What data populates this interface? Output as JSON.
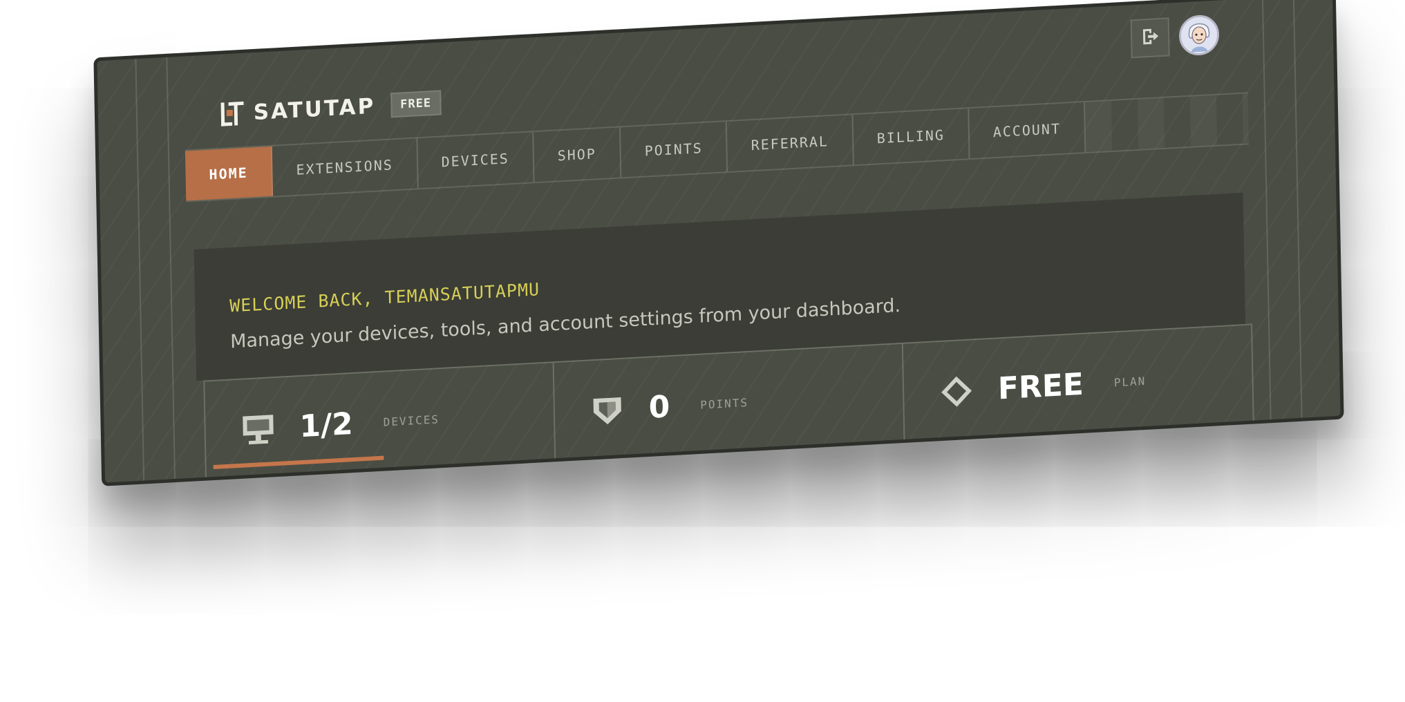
{
  "brand": {
    "name": "SATUTAP",
    "plan_badge": "FREE",
    "logo_icon": "satutap-logo-icon"
  },
  "header": {
    "logout_icon": "logout-icon",
    "avatar_icon": "avatar-icon"
  },
  "nav": {
    "items": [
      {
        "label": "HOME",
        "active": true
      },
      {
        "label": "EXTENSIONS",
        "active": false
      },
      {
        "label": "DEVICES",
        "active": false
      },
      {
        "label": "SHOP",
        "active": false
      },
      {
        "label": "POINTS",
        "active": false
      },
      {
        "label": "REFERRAL",
        "active": false
      },
      {
        "label": "BILLING",
        "active": false
      },
      {
        "label": "ACCOUNT",
        "active": false
      }
    ]
  },
  "welcome": {
    "title": "WELCOME BACK, TEMANSATUTAPMU",
    "subtitle": "Manage your devices, tools, and account settings from your dashboard."
  },
  "stats": {
    "devices": {
      "value": "1/2",
      "label": "DEVICES",
      "icon": "monitor-icon",
      "progress": 0.5
    },
    "points": {
      "value": "0",
      "label": "POINTS",
      "icon": "shield-icon"
    },
    "plan": {
      "value": "FREE",
      "label": "PLAN",
      "icon": "diamond-icon"
    }
  },
  "colors": {
    "background": "#4a4d44",
    "accent": "#b66f47",
    "welcome_title": "#d7cf57",
    "panel": "#3b3d36"
  }
}
